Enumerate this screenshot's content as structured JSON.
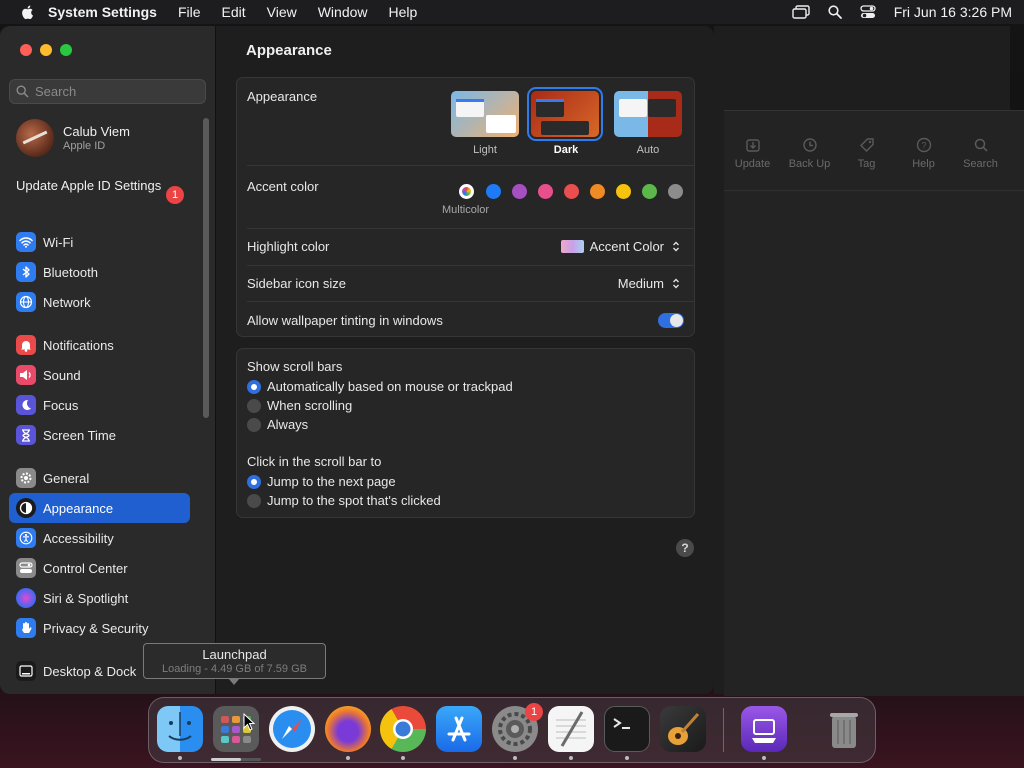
{
  "menubar": {
    "app_name": "System Settings",
    "items": [
      "File",
      "Edit",
      "View",
      "Window",
      "Help"
    ],
    "datetime": "Fri Jun 16  3:26 PM"
  },
  "sidebar": {
    "search_placeholder": "Search",
    "profile": {
      "name": "Calub Viem",
      "sub": "Apple ID"
    },
    "update": {
      "label": "Update Apple ID Settings",
      "badge": "1"
    },
    "groups": [
      [
        {
          "label": "Wi-Fi",
          "icon": "wifi-icon",
          "color": "#2f7bf0"
        },
        {
          "label": "Bluetooth",
          "icon": "bluetooth-icon",
          "color": "#2f7bf0"
        },
        {
          "label": "Network",
          "icon": "globe-icon",
          "color": "#2f7bf0"
        }
      ],
      [
        {
          "label": "Notifications",
          "icon": "bell-icon",
          "color": "#ea4a4a"
        },
        {
          "label": "Sound",
          "icon": "speaker-icon",
          "color": "#ea4a6a"
        },
        {
          "label": "Focus",
          "icon": "moon-icon",
          "color": "#5a55d8"
        },
        {
          "label": "Screen Time",
          "icon": "hourglass-icon",
          "color": "#5a55d8"
        }
      ],
      [
        {
          "label": "General",
          "icon": "gear-icon",
          "color": "#8a8a8a"
        },
        {
          "label": "Appearance",
          "icon": "appearance-icon",
          "color": "#1b1b1b",
          "active": true
        },
        {
          "label": "Accessibility",
          "icon": "accessibility-icon",
          "color": "#2f7bf0"
        },
        {
          "label": "Control Center",
          "icon": "control-center-icon",
          "color": "#8a8a8a"
        },
        {
          "label": "Siri & Spotlight",
          "icon": "siri-icon",
          "color": "#c03ad0"
        },
        {
          "label": "Privacy & Security",
          "icon": "hand-icon",
          "color": "#2f7bf0"
        }
      ],
      [
        {
          "label": "Desktop & Dock",
          "icon": "dock-icon",
          "color": "#1b1b1b"
        }
      ]
    ]
  },
  "content": {
    "title": "Appearance",
    "appearance": {
      "label": "Appearance",
      "options": [
        "Light",
        "Dark",
        "Auto"
      ],
      "selected": "Dark"
    },
    "accent": {
      "label": "Accent color",
      "multicolor_label": "Multicolor",
      "colors": [
        "multicolor",
        "#1f7bf5",
        "#a64fc0",
        "#e8508d",
        "#ea4f4f",
        "#f08a24",
        "#f5c20e",
        "#5cb84a",
        "#8c8c8c"
      ]
    },
    "highlight": {
      "label": "Highlight color",
      "value": "Accent Color"
    },
    "icon_size": {
      "label": "Sidebar icon size",
      "value": "Medium"
    },
    "tinting": {
      "label": "Allow wallpaper tinting in windows",
      "on": true
    },
    "scroll_bars": {
      "label": "Show scroll bars",
      "options": [
        "Automatically based on mouse or trackpad",
        "When scrolling",
        "Always"
      ],
      "selected": 0
    },
    "click_scroll": {
      "label": "Click in the scroll bar to",
      "options": [
        "Jump to the next page",
        "Jump to the spot that's clicked"
      ],
      "selected": 0
    },
    "help": "?"
  },
  "background_window": {
    "toolbar": [
      "Update",
      "Back Up",
      "Tag",
      "Help",
      "Search"
    ]
  },
  "tooltip": {
    "title": "Launchpad",
    "detail": "Loading - 4.49 GB of 7.59 GB"
  },
  "dock": {
    "apps": [
      "Finder",
      "Launchpad",
      "Safari",
      "Firefox",
      "Chrome",
      "App Store",
      "System Settings",
      "TextEdit",
      "Terminal",
      "GarageBand",
      "Apple Configurator",
      "Trash"
    ],
    "settings_badge": "1",
    "launchpad_progress": 0.59
  }
}
